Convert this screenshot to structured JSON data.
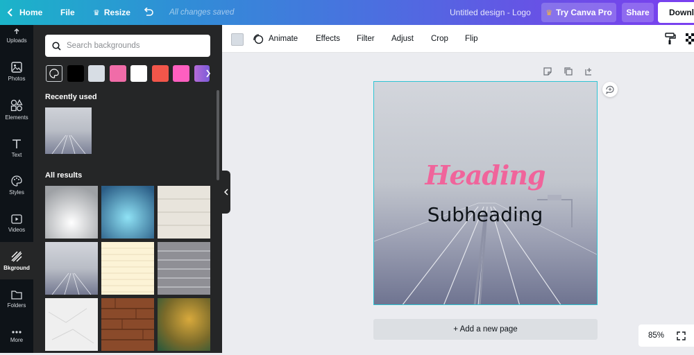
{
  "topbar": {
    "home": "Home",
    "file": "File",
    "resize": "Resize",
    "saved_status": "All changes saved",
    "doc_title": "Untitled design - Logo",
    "try_pro": "Try Canva Pro",
    "share": "Share",
    "download": "Download"
  },
  "rail": {
    "items": [
      {
        "label": "Uploads",
        "icon": "cloud-upload-icon"
      },
      {
        "label": "Photos",
        "icon": "image-icon"
      },
      {
        "label": "Elements",
        "icon": "shapes-icon"
      },
      {
        "label": "Text",
        "icon": "text-icon"
      },
      {
        "label": "Styles",
        "icon": "palette-icon"
      },
      {
        "label": "Videos",
        "icon": "video-icon"
      },
      {
        "label": "Bkground",
        "icon": "background-icon"
      },
      {
        "label": "Folders",
        "icon": "folder-icon"
      },
      {
        "label": "More",
        "icon": "more-icon"
      }
    ]
  },
  "panel": {
    "search_placeholder": "Search backgrounds",
    "swatch_colors": [
      "#000000",
      "#d7dde4",
      "#f06ca8",
      "#ffffff",
      "#f2564a",
      "#ff5fc0"
    ],
    "recently_used": "Recently used",
    "all_results": "All results"
  },
  "toolbar": {
    "animate": "Animate",
    "effects": "Effects",
    "filter": "Filter",
    "adjust": "Adjust",
    "crop": "Crop",
    "flip": "Flip",
    "bg_color": "#d7dde4"
  },
  "canvas": {
    "heading": "Heading",
    "subheading": "Subheading",
    "heading_color": "#f0649b",
    "add_page": "+ Add a new page",
    "zoom": "85%"
  }
}
